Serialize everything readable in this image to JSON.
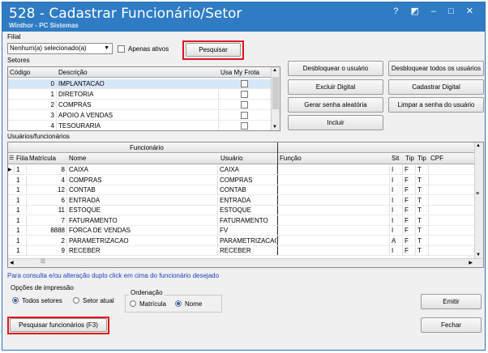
{
  "window": {
    "title": "528 - Cadastrar Funcionário/Setor",
    "subtitle": "Winthor - PC Sistemas",
    "controls": "? ◩ – □ ✕"
  },
  "filter": {
    "filial_label": "Filial",
    "filial_value": "Nenhum(a) selecionado(a)",
    "apenas_ativos_label": "Apenas ativos",
    "pesquisar_label": "Pesquisar"
  },
  "setores": {
    "label": "Setores",
    "columns": [
      "Código",
      "Descrição",
      "Usa My Frota"
    ],
    "rows": [
      {
        "codigo": "0",
        "descricao": "IMPLANTACAO"
      },
      {
        "codigo": "1",
        "descricao": "DIRETORIA"
      },
      {
        "codigo": "2",
        "descricao": "COMPRAS"
      },
      {
        "codigo": "3",
        "descricao": "APOIO A VENDAS"
      },
      {
        "codigo": "4",
        "descricao": "TESOURARIA"
      }
    ]
  },
  "actions": {
    "desbloquear_usuario": "Desbloquear o usuário",
    "desbloquear_todos": "Desbloquear todos os usuários",
    "excluir_digital": "Excluir Digital",
    "cadastrar_digital": "Cadastrar Digital",
    "gerar_senha": "Gerar senha aleatória",
    "limpar_senha": "Limpar a senha do usuário",
    "incluir": "Incluir"
  },
  "usuarios": {
    "label": "Usuários/funcionários",
    "group_header": "Funcionário",
    "columns": [
      "Filia",
      "Matrícula",
      "Nome",
      "Usuário",
      "Função",
      "Sit",
      "Tip",
      "Tip",
      "CPF"
    ],
    "rows": [
      {
        "filial": "1",
        "matricula": "8",
        "nome": "CAIXA",
        "usuario": "CAIXA",
        "sit": "I",
        "tip1": "F",
        "tip2": "T"
      },
      {
        "filial": "1",
        "matricula": "4",
        "nome": "COMPRAS",
        "usuario": "COMPRAS",
        "sit": "I",
        "tip1": "F",
        "tip2": "T"
      },
      {
        "filial": "1",
        "matricula": "12",
        "nome": "CONTAB",
        "usuario": "CONTAB",
        "sit": "I",
        "tip1": "F",
        "tip2": "T"
      },
      {
        "filial": "1",
        "matricula": "6",
        "nome": "ENTRADA",
        "usuario": "ENTRADA",
        "sit": "I",
        "tip1": "F",
        "tip2": "T"
      },
      {
        "filial": "1",
        "matricula": "11",
        "nome": "ESTOQUE",
        "usuario": "ESTOQUE",
        "sit": "I",
        "tip1": "F",
        "tip2": "T"
      },
      {
        "filial": "1",
        "matricula": "7",
        "nome": "FATURAMENTO",
        "usuario": "FATURAMENTO",
        "sit": "I",
        "tip1": "F",
        "tip2": "T"
      },
      {
        "filial": "1",
        "matricula": "8888",
        "nome": "FORCA DE VENDAS",
        "usuario": "FV",
        "sit": "I",
        "tip1": "F",
        "tip2": "T"
      },
      {
        "filial": "1",
        "matricula": "2",
        "nome": "PARAMETRIZACAO",
        "usuario": "PARAMETRIZACAO",
        "sit": "A",
        "tip1": "F",
        "tip2": "T"
      },
      {
        "filial": "1",
        "matricula": "9",
        "nome": "RECEBER",
        "usuario": "RECEBER",
        "sit": "I",
        "tip1": "F",
        "tip2": "T"
      }
    ],
    "hint": "Para consulta e/ou alteração duplo click em cima do funcionário desejado"
  },
  "print_options": {
    "label": "Opções de impressão",
    "todos_setores": "Todos setores",
    "setor_atual": "Setor atual",
    "ordenacao_label": "Ordenação",
    "matricula": "Matrícula",
    "nome": "Nome"
  },
  "footer": {
    "pesquisar_funcionarios": "Pesquisar funcionários (F3)",
    "emitir": "Emitir",
    "fechar": "Fechar"
  },
  "colors": {
    "titlebar": "#2f7cc4",
    "highlight": "#e0141c",
    "link": "#1a3fbf"
  }
}
